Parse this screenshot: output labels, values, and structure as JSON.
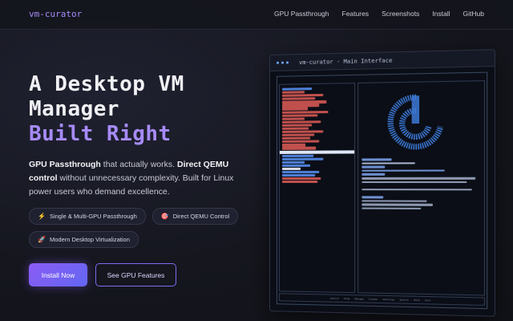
{
  "nav": {
    "brand": "vm-curator",
    "links": [
      "GPU Passthrough",
      "Features",
      "Screenshots",
      "Install",
      "GitHub"
    ]
  },
  "hero": {
    "title_line1": "A Desktop VM",
    "title_line2": "Manager",
    "title_accent": "Built Right",
    "lead_b1": "GPU Passthrough",
    "lead_t1": " that actually works. ",
    "lead_b2": "Direct QEMU control",
    "lead_t2": " without unnecessary complexity. Built for Linux power users who demand excellence."
  },
  "pills": [
    {
      "icon": "lightning-icon",
      "glyph": "⚡",
      "label": "Single & Multi-GPU Passthrough"
    },
    {
      "icon": "target-icon",
      "glyph": "🎯",
      "label": "Direct QEMU Control"
    },
    {
      "icon": "rocket-icon",
      "glyph": "🚀",
      "label": "Modern Desktop Virtualization"
    }
  ],
  "buttons": {
    "primary": "Install Now",
    "secondary": "See GPU Features"
  },
  "window": {
    "title": "vm-curator - Main Interface",
    "footer_items": [
      "Launch",
      "Stop",
      "Manage",
      "Create",
      "Settings",
      "Search",
      "Help",
      "Quit"
    ]
  },
  "colors": {
    "accent": "#a78bfa",
    "primary_gradient": [
      "#8b5cf6",
      "#6366f1"
    ],
    "terminal_blue": "#4b8be8"
  }
}
